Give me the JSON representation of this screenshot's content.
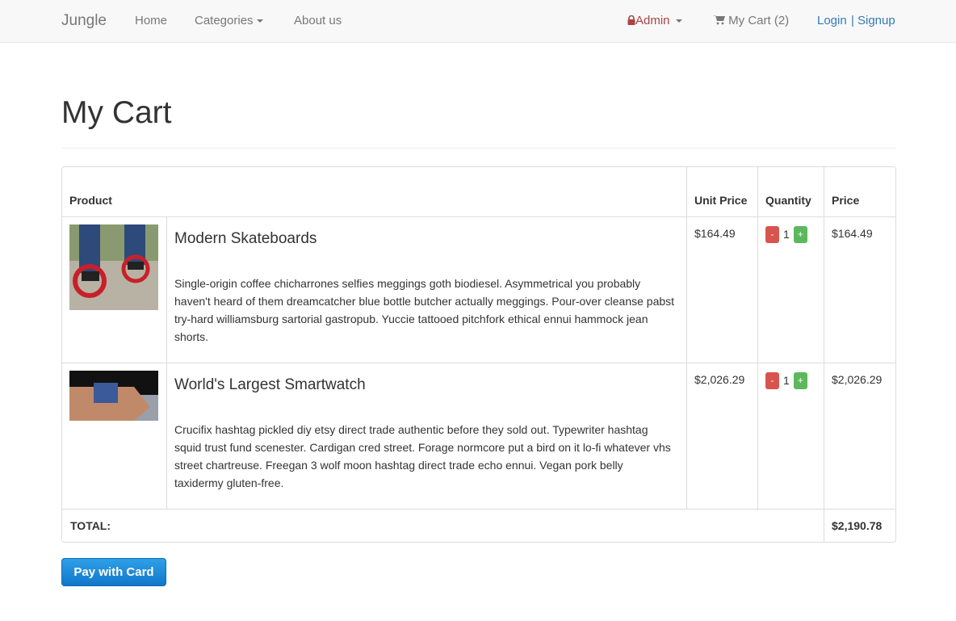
{
  "nav": {
    "brand": "Jungle",
    "home": "Home",
    "categories": "Categories",
    "about": "About us",
    "admin": "Admin",
    "cart": "My Cart (2)",
    "login": "Login",
    "sep": "|",
    "signup": "Signup"
  },
  "page": {
    "title": "My Cart"
  },
  "table": {
    "headers": {
      "product": "Product",
      "unit_price": "Unit Price",
      "quantity": "Quantity",
      "price": "Price"
    },
    "items": [
      {
        "name": "Modern Skateboards",
        "description": "Single-origin coffee chicharrones selfies meggings goth biodiesel. Asymmetrical you probably haven't heard of them dreamcatcher blue bottle butcher actually meggings. Pour-over cleanse pabst try-hard williamsburg sartorial gastropub. Yuccie tattooed pitchfork ethical ennui hammock jean shorts.",
        "unit_price": "$164.49",
        "quantity": "1",
        "price": "$164.49",
        "minus": "-",
        "plus": "+"
      },
      {
        "name": "World's Largest Smartwatch",
        "description": "Crucifix hashtag pickled diy etsy direct trade authentic before they sold out. Typewriter hashtag squid trust fund scenester. Cardigan cred street. Forage normcore put a bird on it lo-fi whatever vhs street chartreuse. Freegan 3 wolf moon hashtag direct trade echo ennui. Vegan pork belly taxidermy gluten-free.",
        "unit_price": "$2,026.29",
        "quantity": "1",
        "price": "$2,026.29",
        "minus": "-",
        "plus": "+"
      }
    ],
    "total_label": "TOTAL:",
    "total": "$2,190.78"
  },
  "pay_button": "Pay with Card"
}
